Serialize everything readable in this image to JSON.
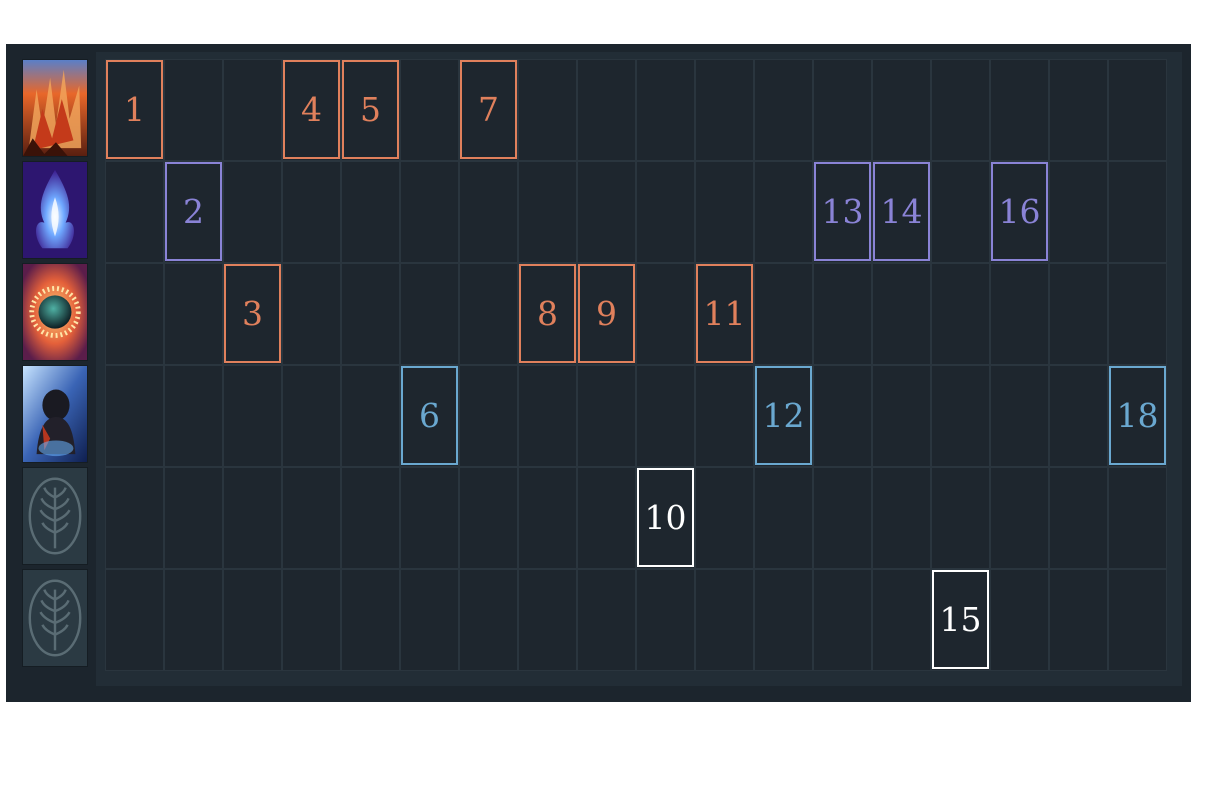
{
  "colors": {
    "fire": "#e0805c",
    "arcane": "#8a83d6",
    "frost": "#6aa8d0",
    "neutral": "#ffffff"
  },
  "rows": [
    {
      "icon": "fire-spell-icon",
      "color_key": "fire"
    },
    {
      "icon": "arcane-flame-icon",
      "color_key": "arcane"
    },
    {
      "icon": "sun-orb-icon",
      "color_key": "fire"
    },
    {
      "icon": "frost-warrior-icon",
      "color_key": "frost"
    },
    {
      "icon": "empty-wheat-slot-icon",
      "color_key": "neutral"
    },
    {
      "icon": "empty-wheat-slot-icon",
      "color_key": "neutral"
    }
  ],
  "grid": {
    "columns": 18,
    "rows": 6
  },
  "cards": [
    {
      "label": "1",
      "row": 0,
      "col": 0
    },
    {
      "label": "2",
      "row": 1,
      "col": 1
    },
    {
      "label": "3",
      "row": 2,
      "col": 2
    },
    {
      "label": "4",
      "row": 0,
      "col": 3
    },
    {
      "label": "5",
      "row": 0,
      "col": 4
    },
    {
      "label": "6",
      "row": 3,
      "col": 5
    },
    {
      "label": "7",
      "row": 0,
      "col": 6
    },
    {
      "label": "8",
      "row": 2,
      "col": 7
    },
    {
      "label": "9",
      "row": 2,
      "col": 8
    },
    {
      "label": "10",
      "row": 4,
      "col": 9
    },
    {
      "label": "11",
      "row": 2,
      "col": 10
    },
    {
      "label": "12",
      "row": 3,
      "col": 11
    },
    {
      "label": "13",
      "row": 1,
      "col": 12
    },
    {
      "label": "14",
      "row": 1,
      "col": 13
    },
    {
      "label": "15",
      "row": 5,
      "col": 14
    },
    {
      "label": "16",
      "row": 1,
      "col": 15
    },
    {
      "label": "18",
      "row": 3,
      "col": 17
    }
  ]
}
